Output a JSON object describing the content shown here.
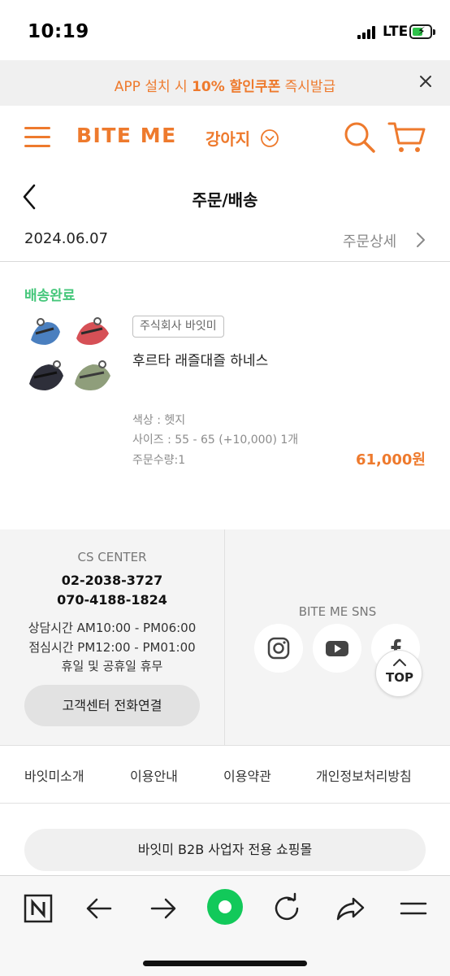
{
  "status_bar": {
    "time": "10:19",
    "network": "LTE"
  },
  "promo": {
    "prefix": "APP 설치 시 ",
    "highlight": "10% 할인쿠폰",
    "suffix": " 즉시발급"
  },
  "header": {
    "logo": "BITE ME",
    "category": "강아지"
  },
  "page": {
    "title": "주문/배송"
  },
  "order": {
    "date": "2024.06.07",
    "detail_link": "주문상세",
    "status": "배송완료",
    "seller": "주식회사 바잇미",
    "product_name": "후르타 래즐대즐 하네스",
    "option_color": "색상 : 헷지",
    "option_size": "사이즈 : 55 - 65 (+10,000)  1개",
    "quantity": "주문수량:1",
    "price": "61,000원"
  },
  "cs": {
    "title": "CS CENTER",
    "phone1": "02-2038-3727",
    "phone2": "070-4188-1824",
    "hours1": "상담시간 AM10:00 - PM06:00",
    "hours2": "점심시간 PM12:00 - PM01:00",
    "hours3": "휴일 및 공휴일 휴무",
    "call_button": "고객센터 전화연결"
  },
  "sns": {
    "title": "BITE ME SNS",
    "icons": [
      "instagram-icon",
      "youtube-icon",
      "facebook-icon"
    ]
  },
  "top_button": "TOP",
  "footer_links": [
    "바잇미소개",
    "이용안내",
    "이용약관",
    "개인정보처리방침"
  ],
  "b2b_button": "바잇미 B2B 사업자 전용 쇼핑몰",
  "colors": {
    "accent": "#ee7a2d",
    "status_green": "#46c77b",
    "naver_green": "#12c95a"
  }
}
